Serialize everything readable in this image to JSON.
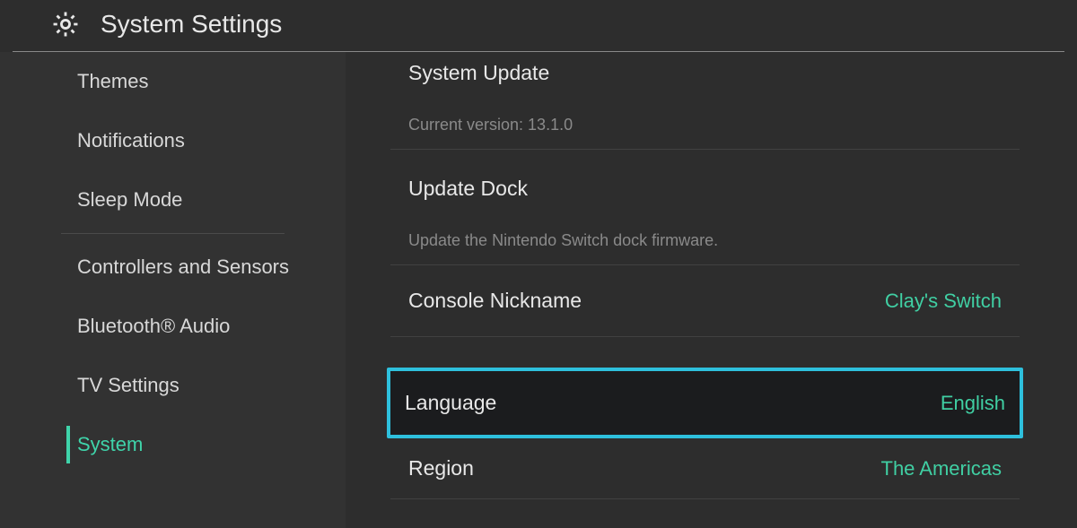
{
  "header": {
    "title": "System Settings"
  },
  "sidebar": {
    "items": [
      {
        "label": "Themes"
      },
      {
        "label": "Notifications"
      },
      {
        "label": "Sleep Mode"
      },
      {
        "label": "Controllers and Sensors"
      },
      {
        "label": "Bluetooth® Audio"
      },
      {
        "label": "TV Settings"
      },
      {
        "label": "System"
      }
    ]
  },
  "main": {
    "system_update": {
      "label": "System Update",
      "sub": "Current version: 13.1.0"
    },
    "update_dock": {
      "label": "Update Dock",
      "sub": "Update the Nintendo Switch dock firmware."
    },
    "nickname": {
      "label": "Console Nickname",
      "value": "Clay's Switch"
    },
    "language": {
      "label": "Language",
      "value": "English"
    },
    "region": {
      "label": "Region",
      "value": "The Americas"
    }
  },
  "colors": {
    "accent": "#3fd4aa",
    "highlight": "#2ec0dd"
  }
}
